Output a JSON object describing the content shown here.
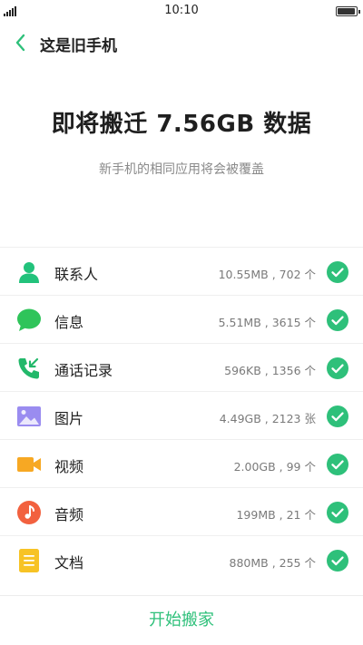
{
  "status_bar": {
    "time": "10:10",
    "signal_icon": "signal-icon",
    "battery_icon": "battery-icon",
    "battery_level": 1.0
  },
  "header": {
    "back_icon": "chevron-left-icon",
    "title": "这是旧手机"
  },
  "hero": {
    "title": "即将搬迁 7.56GB 数据",
    "subtitle": "新手机的相同应用将会被覆盖"
  },
  "items": [
    {
      "label": "联系人",
      "detail": "10.55MB , 702 个",
      "icon": "contacts-icon",
      "color": "#22c27b",
      "checked": true
    },
    {
      "label": "信息",
      "detail": "5.51MB , 3615 个",
      "icon": "message-icon",
      "color": "#2fc45a",
      "checked": true
    },
    {
      "label": "通话记录",
      "detail": "596KB , 1356 个",
      "icon": "call-log-icon",
      "color": "#22b86a",
      "checked": true
    },
    {
      "label": "图片",
      "detail": "4.49GB , 2123 张",
      "icon": "picture-icon",
      "color": "#9a8cf0",
      "checked": true
    },
    {
      "label": "视频",
      "detail": "2.00GB , 99 个",
      "icon": "video-icon",
      "color": "#f7a823",
      "checked": true
    },
    {
      "label": "音频",
      "detail": "199MB , 21 个",
      "icon": "audio-icon",
      "color": "#f2613f",
      "checked": true
    },
    {
      "label": "文档",
      "detail": "880MB , 255 个",
      "icon": "document-icon",
      "color": "#f7c325",
      "checked": true
    }
  ],
  "check_color": "#2ec07a",
  "accent_color": "#2ec07a",
  "start_button": "开始搬家"
}
